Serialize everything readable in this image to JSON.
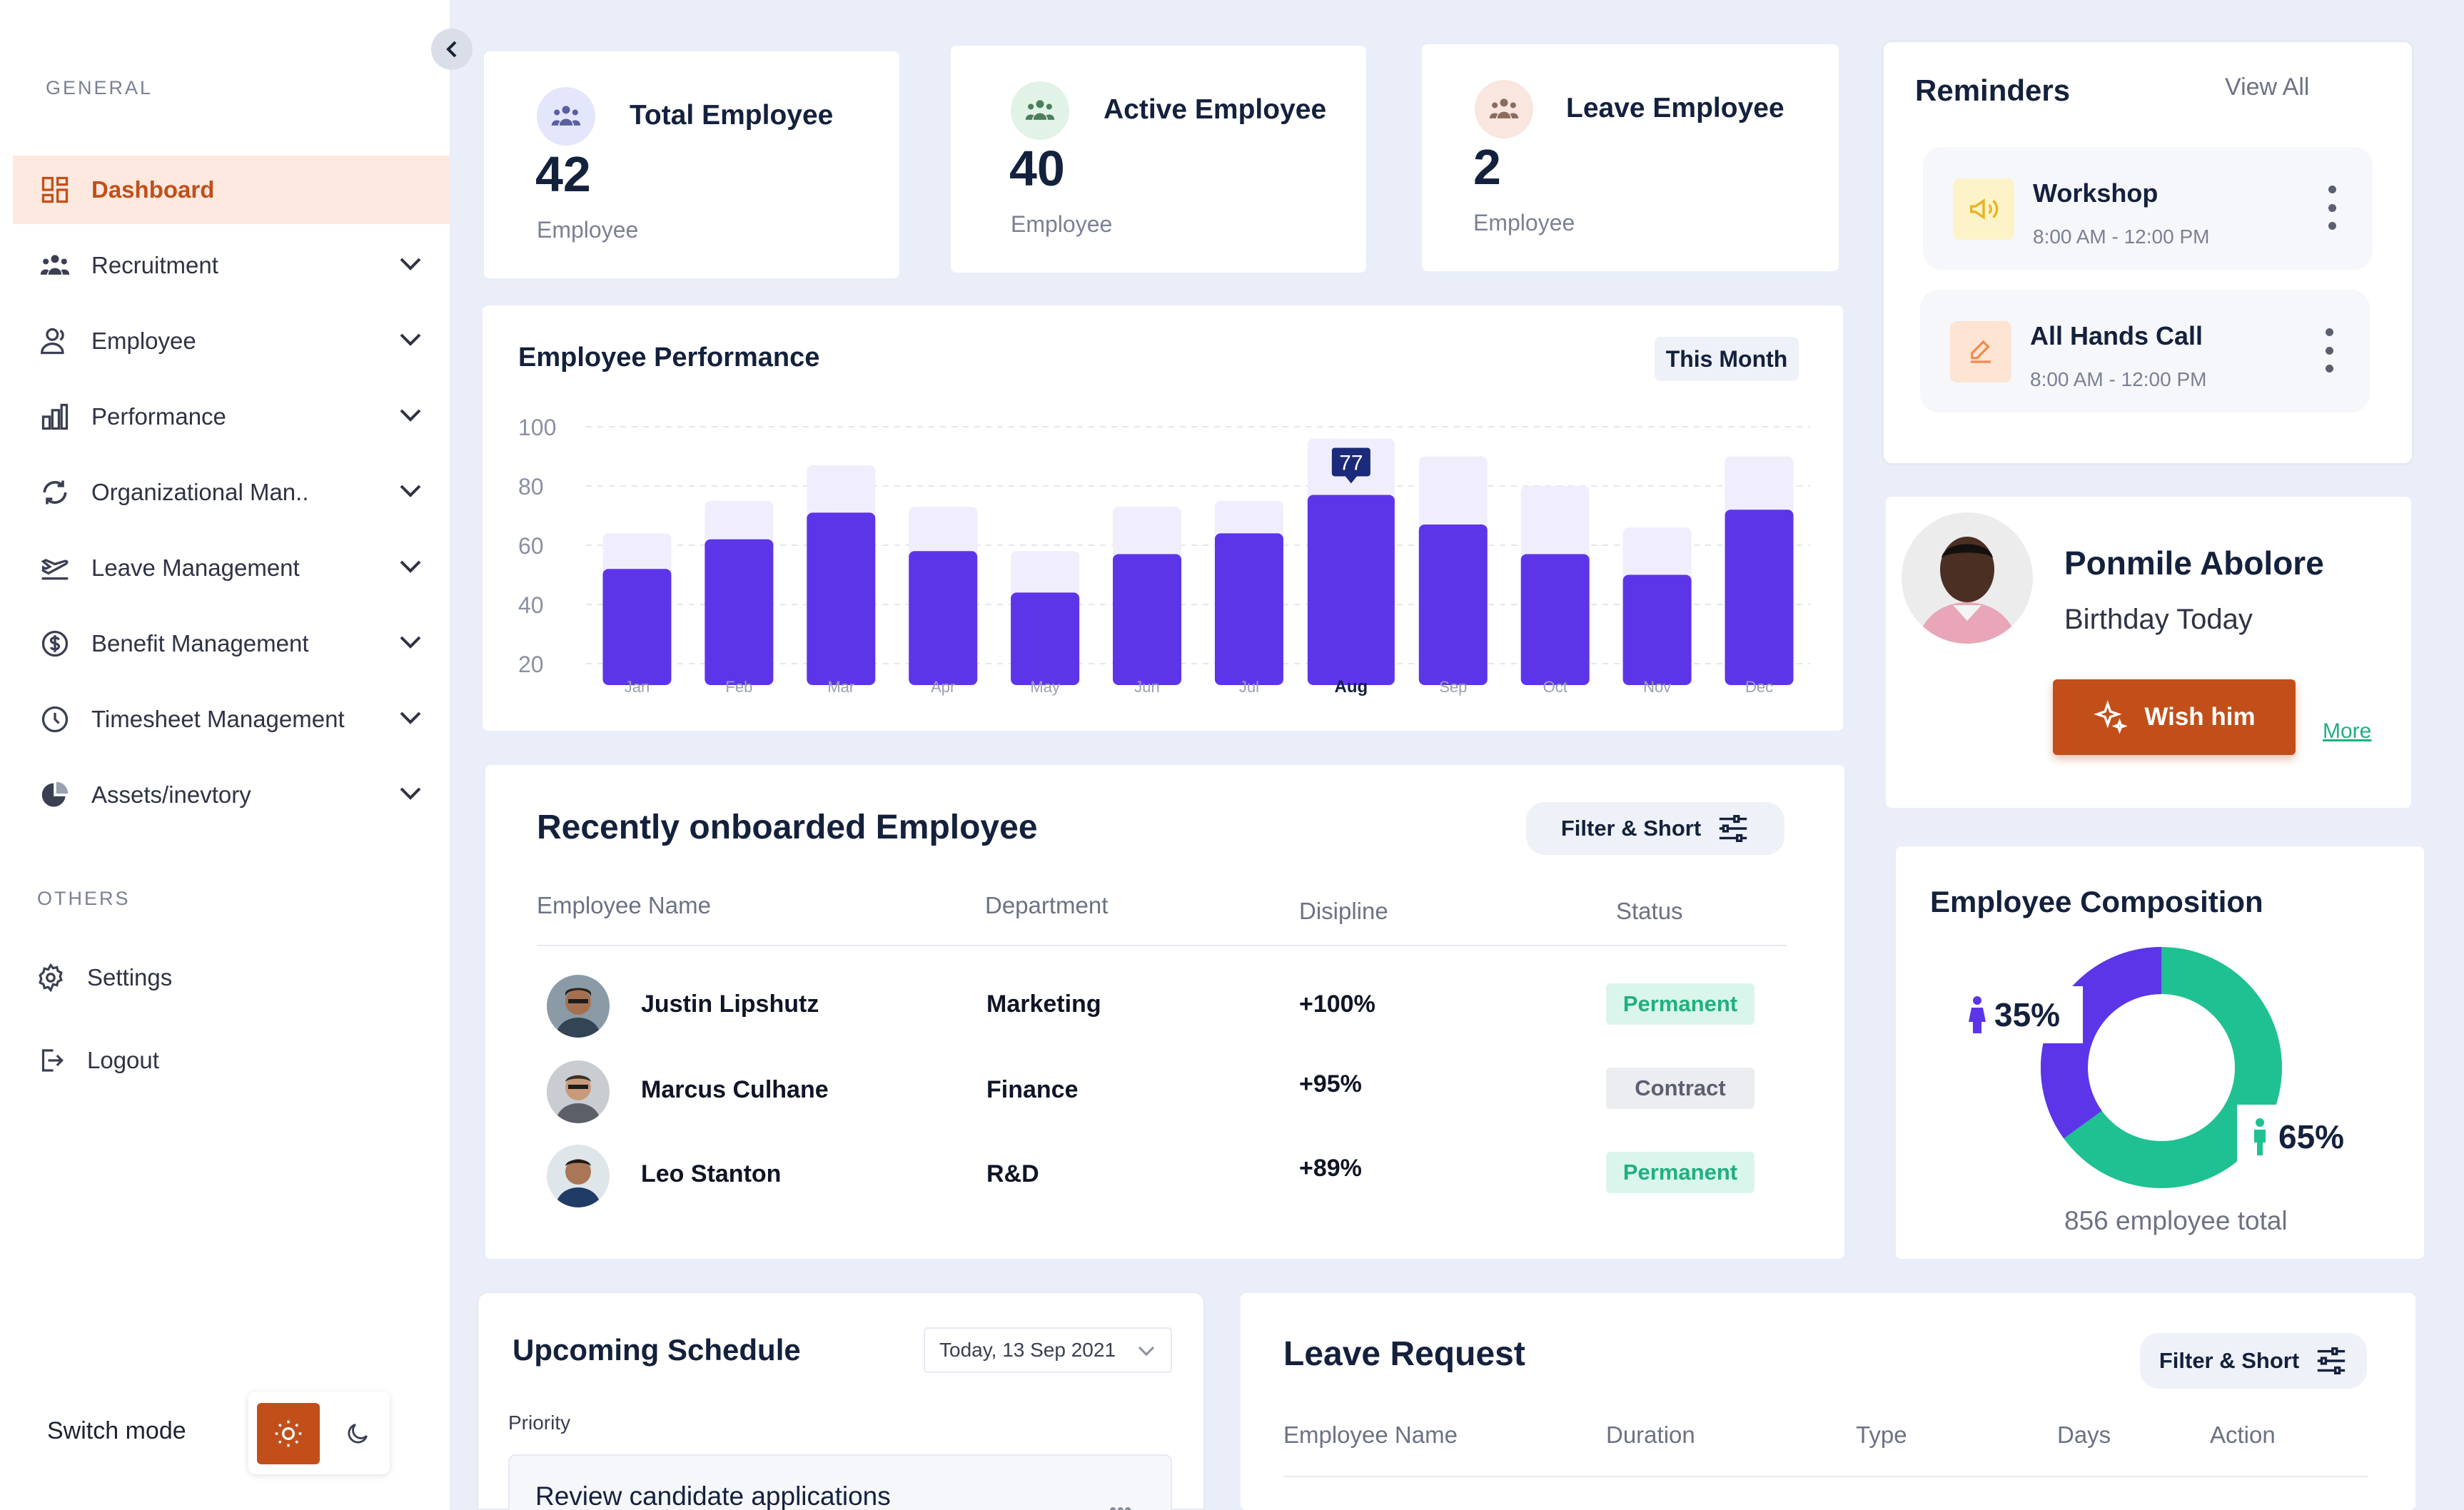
{
  "sidebar": {
    "general_label": "GENERAL",
    "others_label": "OTHERS",
    "items": [
      {
        "label": "Dashboard"
      },
      {
        "label": "Recruitment"
      },
      {
        "label": "Employee"
      },
      {
        "label": "Performance"
      },
      {
        "label": "Organizational Man.."
      },
      {
        "label": "Leave Management"
      },
      {
        "label": "Benefit Management"
      },
      {
        "label": "Timesheet Management"
      },
      {
        "label": "Assets/inevtory"
      }
    ],
    "others": [
      {
        "label": "Settings"
      },
      {
        "label": "Logout"
      }
    ],
    "switch_mode_label": "Switch mode"
  },
  "stats": [
    {
      "title": "Total Employee",
      "value": "42",
      "unit": "Employee"
    },
    {
      "title": "Active Employee",
      "value": "40",
      "unit": "Employee"
    },
    {
      "title": "Leave Employee",
      "value": "2",
      "unit": "Employee"
    }
  ],
  "performance": {
    "title": "Employee Performance",
    "period": "This Month"
  },
  "chart_data": {
    "type": "bar",
    "title": "Employee Performance",
    "categories": [
      "Jan",
      "Feb",
      "Mar",
      "Apr",
      "May",
      "Jun",
      "Jul",
      "Aug",
      "Sep",
      "Oct",
      "Nov",
      "Dec"
    ],
    "series": [
      {
        "values": [
          52,
          62,
          71,
          58,
          44,
          57,
          64,
          77,
          67,
          57,
          50,
          72
        ]
      },
      {
        "values": [
          64,
          75,
          87,
          73,
          58,
          73,
          75,
          96,
          90,
          80,
          66,
          90
        ]
      }
    ],
    "highlight": {
      "category": "Aug",
      "label": "77"
    },
    "yticks": [
      100,
      80,
      60,
      40,
      20
    ],
    "ylim": [
      20,
      100
    ],
    "grid": true,
    "colors": {
      "primary": "#5d35e8",
      "background_bar": "#f0eefc"
    }
  },
  "onboarded": {
    "title": "Recently onboarded Employee",
    "filter_label": "Filter & Short",
    "columns": [
      "Employee Name",
      "Department",
      "Disipline",
      "Status"
    ],
    "rows": [
      {
        "name": "Justin Lipshutz",
        "department": "Marketing",
        "discipline": "+100%",
        "status": "Permanent"
      },
      {
        "name": "Marcus Culhane",
        "department": "Finance",
        "discipline": "+95%",
        "status": "Contract"
      },
      {
        "name": "Leo Stanton",
        "department": "R&D",
        "discipline": "+89%",
        "status": "Permanent"
      }
    ]
  },
  "reminders": {
    "title": "Reminders",
    "view_all": "View All",
    "items": [
      {
        "title": "Workshop",
        "time": "8:00 AM - 12:00 PM",
        "icon": "megaphone-icon"
      },
      {
        "title": "All Hands Call",
        "time": "8:00 AM - 12:00 PM",
        "icon": "edit-icon"
      }
    ]
  },
  "birthday": {
    "name": "Ponmile Abolore",
    "subtitle": "Birthday Today",
    "wish_label": "Wish him",
    "more_label": "More"
  },
  "composition": {
    "title": "Employee Composition",
    "female_pct": "35%",
    "male_pct": "65%",
    "total_text": "856 employee total",
    "female_fraction": 0.35,
    "male_fraction": 0.65,
    "colors": {
      "female": "#5d35e8",
      "male": "#1fc193"
    }
  },
  "schedule": {
    "title": "Upcoming Schedule",
    "date": "Today, 13 Sep 2021",
    "priority_label": "Priority",
    "first_item": "Review candidate applications"
  },
  "leave": {
    "title": "Leave Request",
    "filter_label": "Filter & Short",
    "columns": [
      "Employee Name",
      "Duration",
      "Type",
      "Days",
      "Action"
    ]
  }
}
